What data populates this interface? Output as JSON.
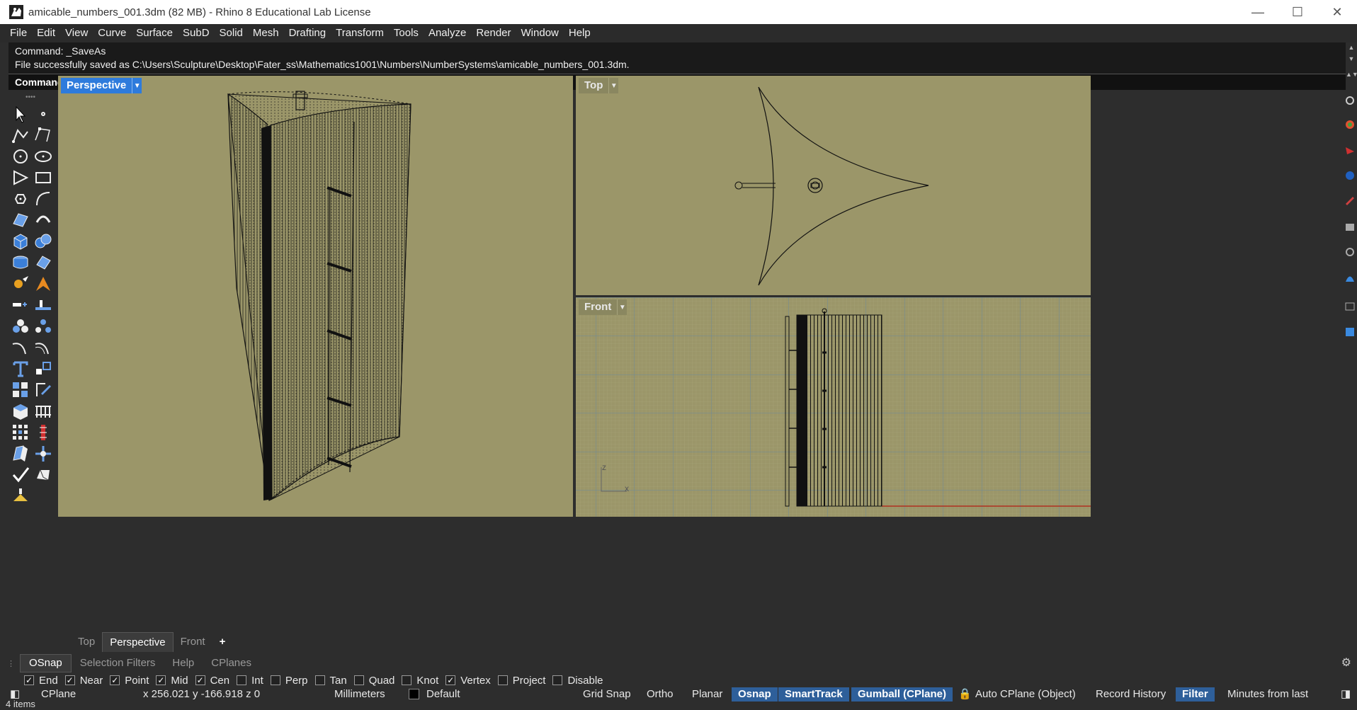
{
  "window": {
    "title": "amicable_numbers_001.3dm (82 MB) - Rhino 8 Educational Lab License",
    "minimize": "—",
    "maximize": "☐",
    "close": "✕"
  },
  "menu": [
    "File",
    "Edit",
    "View",
    "Curve",
    "Surface",
    "SubD",
    "Solid",
    "Mesh",
    "Drafting",
    "Transform",
    "Tools",
    "Analyze",
    "Render",
    "Window",
    "Help"
  ],
  "command": {
    "line1": "Command: _SaveAs",
    "line2": "File successfully saved as C:\\Users\\Sculpture\\Desktop\\Fater_ss\\Mathematics1001\\Numbers\\NumberSystems\\amicable_numbers_001.3dm.",
    "prompt": "Command:"
  },
  "viewports": {
    "perspective": "Perspective",
    "top": "Top",
    "front": "Front",
    "axis_z": "z",
    "axis_x": "x"
  },
  "viewport_tabs": [
    "Top",
    "Perspective",
    "Front",
    "+"
  ],
  "panel_tabs": [
    "OSnap",
    "Selection Filters",
    "Help",
    "CPlanes"
  ],
  "osnaps": [
    {
      "label": "End",
      "checked": true
    },
    {
      "label": "Near",
      "checked": true
    },
    {
      "label": "Point",
      "checked": true
    },
    {
      "label": "Mid",
      "checked": true
    },
    {
      "label": "Cen",
      "checked": true
    },
    {
      "label": "Int",
      "checked": false
    },
    {
      "label": "Perp",
      "checked": false
    },
    {
      "label": "Tan",
      "checked": false
    },
    {
      "label": "Quad",
      "checked": false
    },
    {
      "label": "Knot",
      "checked": false
    },
    {
      "label": "Vertex",
      "checked": true
    },
    {
      "label": "Project",
      "checked": false
    },
    {
      "label": "Disable",
      "checked": false
    }
  ],
  "status": {
    "cplane": "CPlane",
    "coords": "x 256.021  y -166.918  z 0",
    "units": "Millimeters",
    "layer": "Default",
    "grid_snap": "Grid Snap",
    "ortho": "Ortho",
    "planar": "Planar",
    "osnap": "Osnap",
    "smarttrack": "SmartTrack",
    "gumball": "Gumball (CPlane)",
    "autocplane": "Auto CPlane (Object)",
    "record_history": "Record History",
    "filter": "Filter",
    "minutes": "Minutes from last",
    "items": "4 items"
  },
  "colors": {
    "viewport_bg": "#9b9669",
    "active_label": "#2e7bdc",
    "status_pill": "#2e5f9a"
  }
}
